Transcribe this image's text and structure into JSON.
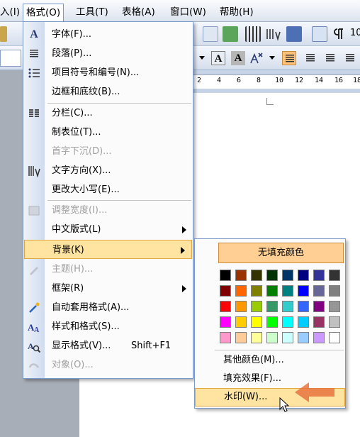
{
  "menubar": {
    "items": [
      {
        "label": "入(I)"
      },
      {
        "label": "格式(O)"
      },
      {
        "label": "工具(T)"
      },
      {
        "label": "表格(A)"
      },
      {
        "label": "窗口(W)"
      },
      {
        "label": "帮助(H)"
      }
    ]
  },
  "toolbar": {
    "zoom_partial": "10",
    "bold_a": "A",
    "shaded_a": "A"
  },
  "ruler": {
    "numbers": [
      "2",
      "4",
      "6",
      "8",
      "10",
      "12",
      "14",
      "16",
      "18"
    ]
  },
  "format_menu": {
    "items": [
      {
        "label": "字体(F)...",
        "icon": "A"
      },
      {
        "label": "段落(P)..."
      },
      {
        "label": "项目符号和编号(N)..."
      },
      {
        "label": "边框和底纹(B)..."
      },
      {
        "label": "分栏(C)..."
      },
      {
        "label": "制表位(T)..."
      },
      {
        "label": "首字下沉(D)..."
      },
      {
        "label": "文字方向(X)..."
      },
      {
        "label": "更改大小写(E)..."
      },
      {
        "label": "调整宽度(I)..."
      },
      {
        "label": "中文版式(L)"
      },
      {
        "label": "背景(K)"
      },
      {
        "label": "主题(H)..."
      },
      {
        "label": "框架(R)"
      },
      {
        "label": "自动套用格式(A)..."
      },
      {
        "label": "样式和格式(S)..."
      },
      {
        "label": "显示格式(V)...",
        "shortcut": "Shift+F1"
      },
      {
        "label": "对象(O)..."
      }
    ]
  },
  "background_submenu": {
    "no_fill": "无填充颜色",
    "more_colors": "其他颜色(M)...",
    "fill_effects": "填充效果(F)...",
    "watermark": "水印(W)...",
    "palette": [
      [
        "#000000",
        "#993300",
        "#333300",
        "#003300",
        "#003366",
        "#000080",
        "#333399",
        "#333333"
      ],
      [
        "#800000",
        "#FF6600",
        "#808000",
        "#008000",
        "#008080",
        "#0000FF",
        "#666699",
        "#808080"
      ],
      [
        "#FF0000",
        "#FF9900",
        "#99CC00",
        "#339966",
        "#33CCCC",
        "#3366FF",
        "#800080",
        "#969696"
      ],
      [
        "#FF00FF",
        "#FFCC00",
        "#FFFF00",
        "#00FF00",
        "#00FFFF",
        "#00CCFF",
        "#993366",
        "#C0C0C0"
      ],
      [
        "#FF99CC",
        "#FFCC99",
        "#FFFF99",
        "#CCFFCC",
        "#CCFFFF",
        "#99CCFF",
        "#CC99FF",
        "#FFFFFF"
      ]
    ]
  },
  "colors": {
    "highlight": "#FFE3A1",
    "no_fill_bg": "#FFCF93",
    "annotation_arrow": "#E8743F"
  }
}
